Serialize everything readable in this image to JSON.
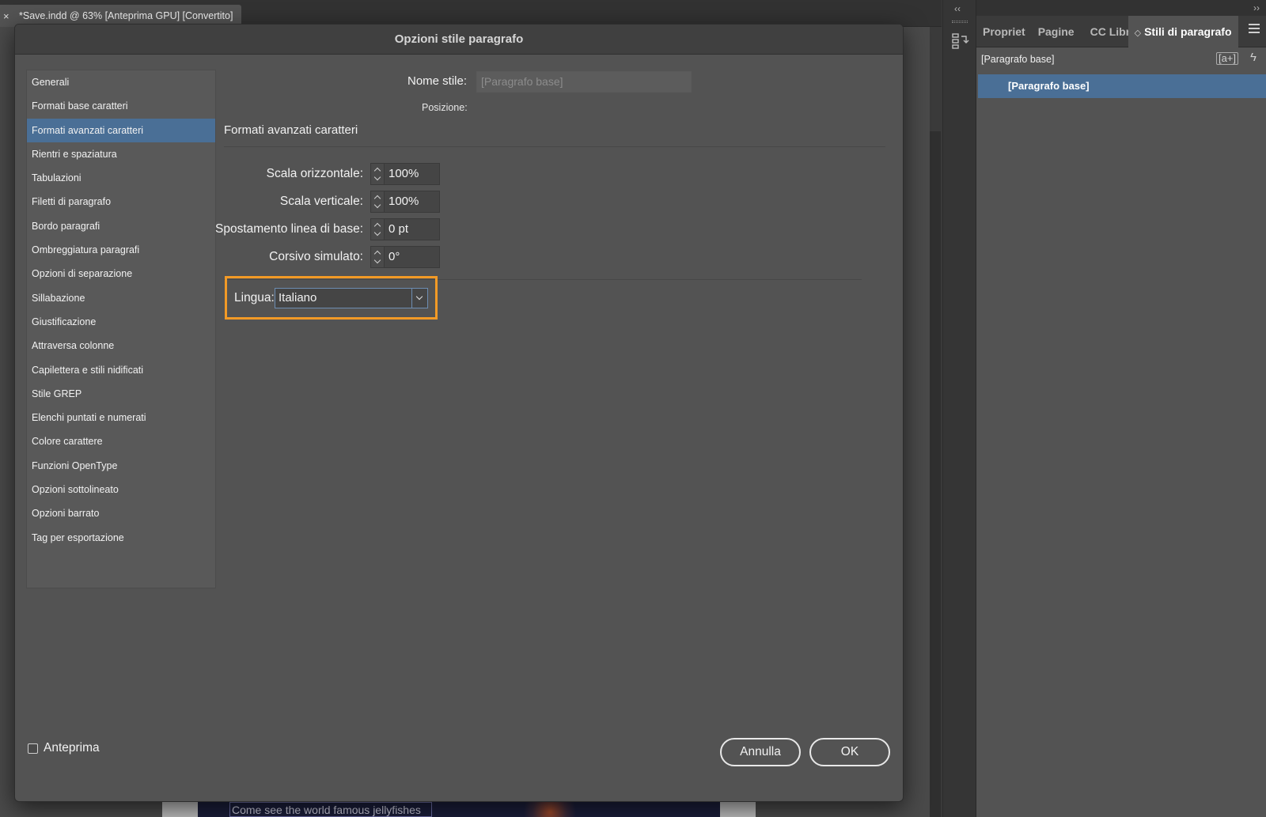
{
  "document": {
    "close_glyph": "×",
    "tab_title": "*Save.indd @ 63% [Anteprima GPU] [Convertito]",
    "canvas_text": "Come see the world famous jellyfishes"
  },
  "toolbar": {
    "collapse_glyph": "‹‹",
    "expand_glyph": "››"
  },
  "panel": {
    "tabs": [
      {
        "label": "Propriet"
      },
      {
        "label": "Pagine"
      },
      {
        "label": "CC Libra"
      },
      {
        "label": "Stili di paragrafo",
        "active": true
      }
    ],
    "arrow_glyph": "◇",
    "current_path": "[Paragrafo base]",
    "new_icon": "[a+]",
    "bolt_icon": "ϟ",
    "selected_item": "[Paragrafo base]"
  },
  "dialog": {
    "title": "Opzioni stile paragrafo",
    "categories": [
      "Generali",
      "Formati base caratteri",
      "Formati avanzati caratteri",
      "Rientri e spaziatura",
      "Tabulazioni",
      "Filetti di paragrafo",
      "Bordo paragrafi",
      "Ombreggiatura paragrafi",
      "Opzioni di separazione",
      "Sillabazione",
      "Giustificazione",
      "Attraversa colonne",
      "Capilettera e stili nidificati",
      "Stile GREP",
      "Elenchi puntati e numerati",
      "Colore carattere",
      "Funzioni OpenType",
      "Opzioni sottolineato",
      "Opzioni barrato",
      "Tag per esportazione"
    ],
    "selected_category_index": 2,
    "style_name_label": "Nome stile:",
    "style_name_value": "[Paragrafo base]",
    "position_label": "Posizione:",
    "section_title": "Formati avanzati caratteri",
    "fields": [
      {
        "label": "Scala orizzontale:",
        "value": "100%"
      },
      {
        "label": "Scala verticale:",
        "value": "100%"
      },
      {
        "label": "Spostamento linea di base:",
        "value": "0 pt"
      },
      {
        "label": "Corsivo simulato:",
        "value": "0°"
      }
    ],
    "language_label": "Lingua:",
    "language_value": "Italiano",
    "highlight_color": "#f29a26",
    "selection_color": "#4a6f96",
    "preview_label": "Anteprima",
    "preview_checked": false,
    "cancel_label": "Annulla",
    "ok_label": "OK"
  }
}
